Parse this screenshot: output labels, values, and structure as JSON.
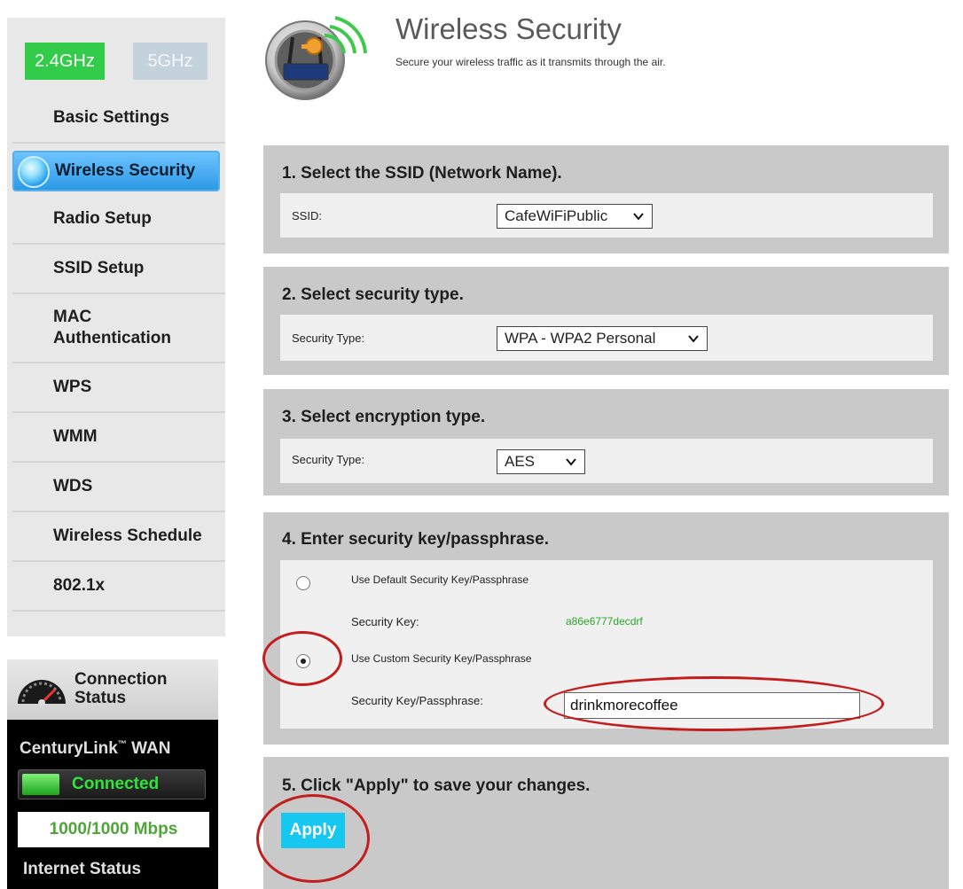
{
  "sidebar": {
    "band_tabs": [
      "2.4GHz",
      "5GHz"
    ],
    "items": [
      {
        "label": "Basic Settings"
      },
      {
        "label": "Wireless Security"
      },
      {
        "label": "Radio Setup"
      },
      {
        "label": "SSID Setup"
      },
      {
        "label": "MAC\nAuthentication"
      },
      {
        "label": "WPS"
      },
      {
        "label": "WMM"
      },
      {
        "label": "WDS"
      },
      {
        "label": "Wireless Schedule"
      },
      {
        "label": "802.1x"
      }
    ]
  },
  "connection": {
    "title": "Connection Status",
    "wan_label": "CenturyLink",
    "wan_tm": "™",
    "wan_suffix": " WAN",
    "status": "Connected",
    "speed": "1000/1000 Mbps",
    "internet_status": "Internet Status"
  },
  "header": {
    "title": "Wireless Security",
    "subtitle": "Secure your wireless traffic as it transmits through the air."
  },
  "sections": {
    "ssid": {
      "title": "1. Select the SSID (Network Name).",
      "label": "SSID:",
      "value": "CafeWiFiPublic"
    },
    "security_type": {
      "title": "2. Select security type.",
      "label": "Security Type:",
      "value": "WPA - WPA2 Personal"
    },
    "encryption": {
      "title": "3. Select encryption type.",
      "label": "Security Type:",
      "value": "AES"
    },
    "key": {
      "title": "4. Enter security key/passphrase.",
      "default_option": "Use Default Security Key/Passphrase",
      "default_key_label": "Security Key:",
      "default_key_value": "a86e6777decdrf",
      "custom_option": "Use Custom Security Key/Passphrase",
      "custom_key_label": "Security Key/Passphrase:",
      "custom_key_value": "drinkmorecoffee"
    },
    "apply": {
      "title": "5. Click \"Apply\" to save your changes.",
      "button": "Apply"
    }
  },
  "colors": {
    "accent_green": "#33cc4a",
    "active_blue": "#2c9ae6",
    "apply_cyan": "#16c8f0",
    "annotation_red": "#c31d1d"
  }
}
